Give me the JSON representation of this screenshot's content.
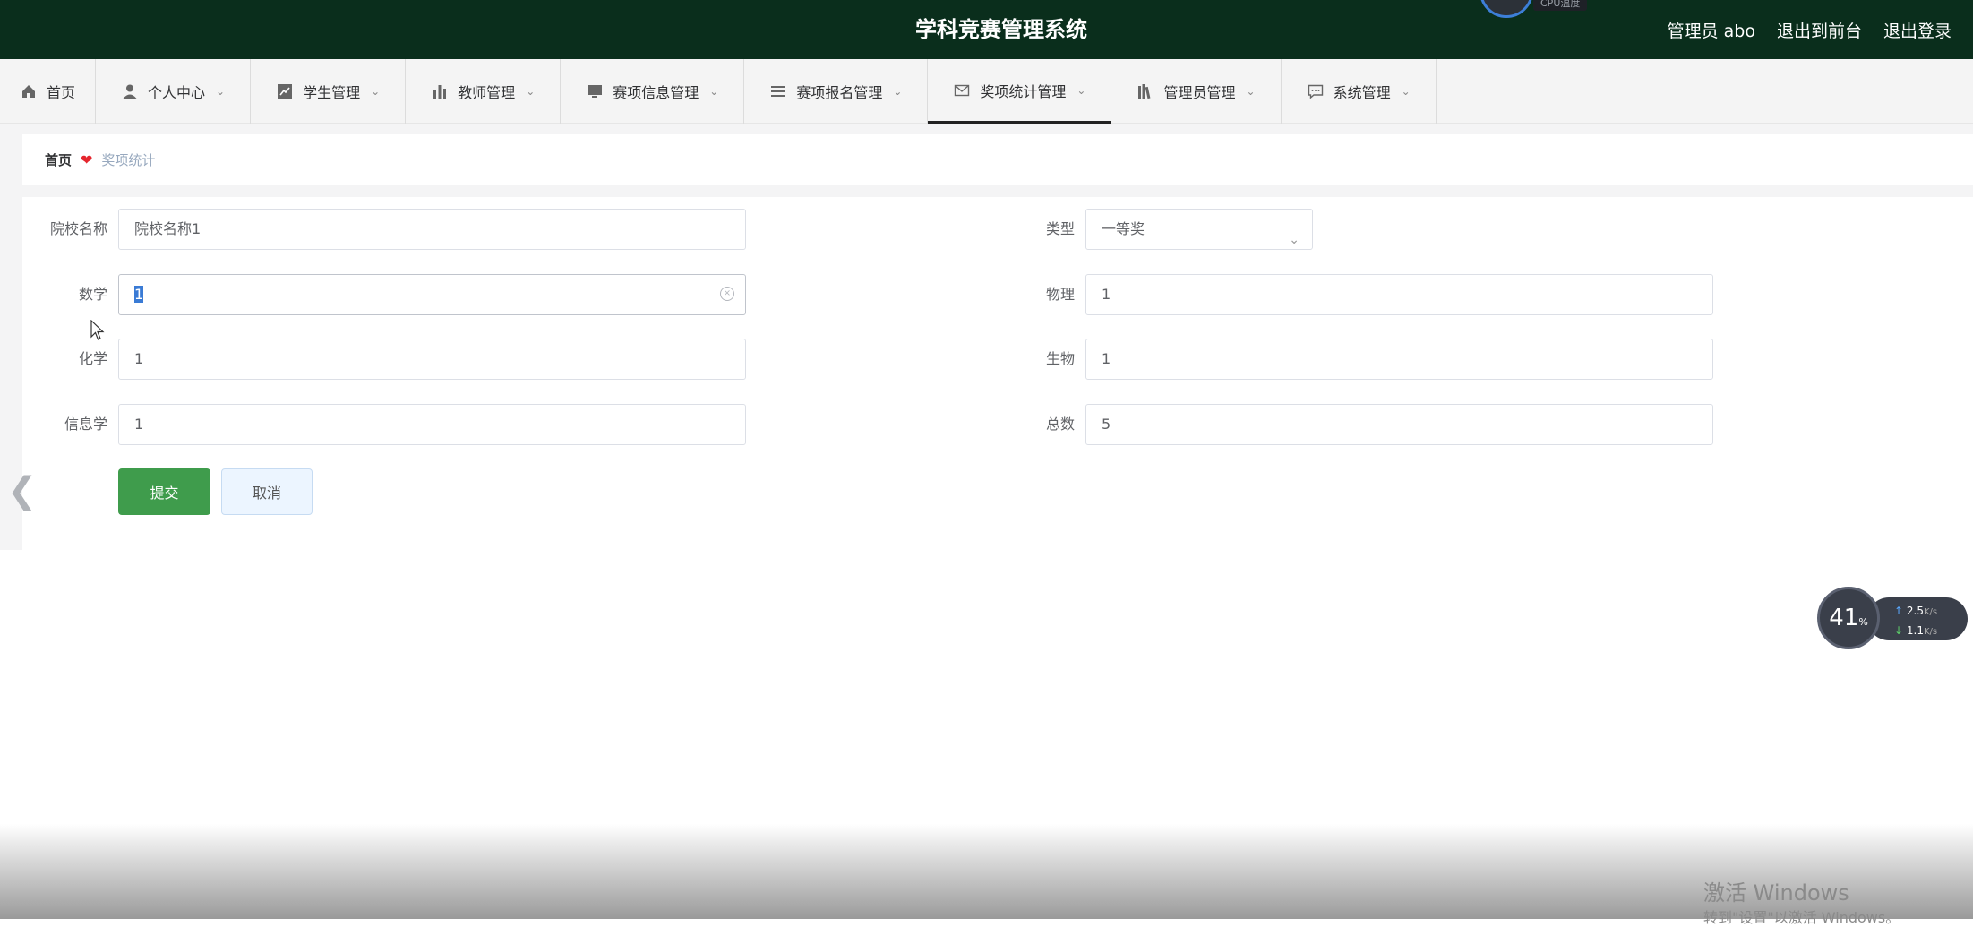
{
  "header": {
    "title": "学科竞赛管理系统",
    "cpu_label": "CPU温度",
    "admin_label": "管理员 abo",
    "front_link": "退出到前台",
    "logout_link": "退出登录"
  },
  "nav": {
    "items": [
      {
        "label": "首页",
        "icon": "home-icon"
      },
      {
        "label": "个人中心",
        "icon": "user-icon"
      },
      {
        "label": "学生管理",
        "icon": "chart-line-icon"
      },
      {
        "label": "教师管理",
        "icon": "bar-chart-icon"
      },
      {
        "label": "赛项信息管理",
        "icon": "monitor-icon"
      },
      {
        "label": "赛项报名管理",
        "icon": "list-icon"
      },
      {
        "label": "奖项统计管理",
        "icon": "mail-icon"
      },
      {
        "label": "管理员管理",
        "icon": "books-icon"
      },
      {
        "label": "系统管理",
        "icon": "chat-icon"
      }
    ],
    "active": "奖项统计管理"
  },
  "breadcrumb": {
    "home": "首页",
    "current": "奖项统计"
  },
  "form": {
    "school_label": "院校名称",
    "school_value": "院校名称1",
    "type_label": "类型",
    "type_value": "一等奖",
    "math_label": "数学",
    "math_value": "1",
    "physics_label": "物理",
    "physics_value": "1",
    "chemistry_label": "化学",
    "chemistry_value": "1",
    "biology_label": "生物",
    "biology_value": "1",
    "informatics_label": "信息学",
    "informatics_value": "1",
    "total_label": "总数",
    "total_value": "5",
    "submit_label": "提交",
    "cancel_label": "取消"
  },
  "net_widget": {
    "percent": "41",
    "percent_unit": "%",
    "upload": "2.5",
    "download": "1.1",
    "unit": "K/s"
  },
  "windows": {
    "activate_title": "激活 Windows",
    "activate_hint": "转到\"设置\"以激活 Windows。"
  },
  "colors": {
    "header_bg": "#0a2e1c",
    "submit_bg": "#3f9c4c",
    "breadcrumb_heart": "#e5262e"
  }
}
